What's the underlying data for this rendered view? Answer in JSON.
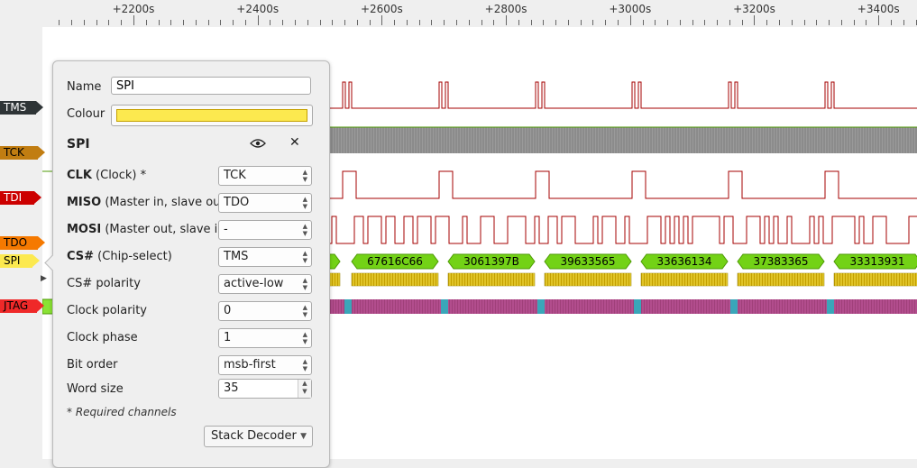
{
  "ruler": {
    "labels": [
      "+2200s",
      "+2400s",
      "+2600s",
      "+2800s",
      "+3000s",
      "+3200s",
      "+3400s"
    ]
  },
  "channels": [
    {
      "name": "TMS",
      "color": "#2e3436",
      "text_color": "#ffffff"
    },
    {
      "name": "TCK",
      "color": "#c17d11",
      "text_color": "#000000"
    },
    {
      "name": "TDI",
      "color": "#cc0000",
      "text_color": "#ffffff"
    },
    {
      "name": "TDO",
      "color": "#f57900",
      "text_color": "#000000"
    },
    {
      "name": "SPI",
      "color": "#fce94f",
      "text_color": "#000000"
    },
    {
      "name": "JTAG",
      "color": "#ef2929",
      "text_color": "#000000"
    }
  ],
  "spi_words": [
    "67616C66",
    "3061397B",
    "39633565",
    "33636134",
    "37383365",
    "33313931"
  ],
  "popup": {
    "name_label": "Name",
    "name_value": "SPI",
    "colour_label": "Colour",
    "colour_value": "#fce94f",
    "decoder_title": "SPI",
    "eye_icon": "eye-icon",
    "close_icon": "close-icon",
    "close_glyph": "✕",
    "rows": [
      {
        "bold": "CLK",
        "rest": " (Clock) *",
        "value": "TCK"
      },
      {
        "bold": "MISO",
        "rest": " (Master in, slave out)",
        "value": "TDO"
      },
      {
        "bold": "MOSI",
        "rest": " (Master out, slave in)",
        "value": "-"
      },
      {
        "bold": "CS#",
        "rest": " (Chip-select)",
        "value": "TMS"
      },
      {
        "bold": "",
        "rest": "CS# polarity",
        "value": "active-low"
      },
      {
        "bold": "",
        "rest": "Clock polarity",
        "value": "0"
      },
      {
        "bold": "",
        "rest": "Clock phase",
        "value": "1"
      },
      {
        "bold": "",
        "rest": "Bit order",
        "value": "msb-first"
      }
    ],
    "word_size_label": "Word size",
    "word_size_value": "35",
    "required_note": "* Required channels",
    "stack_button": "Stack Decoder"
  }
}
